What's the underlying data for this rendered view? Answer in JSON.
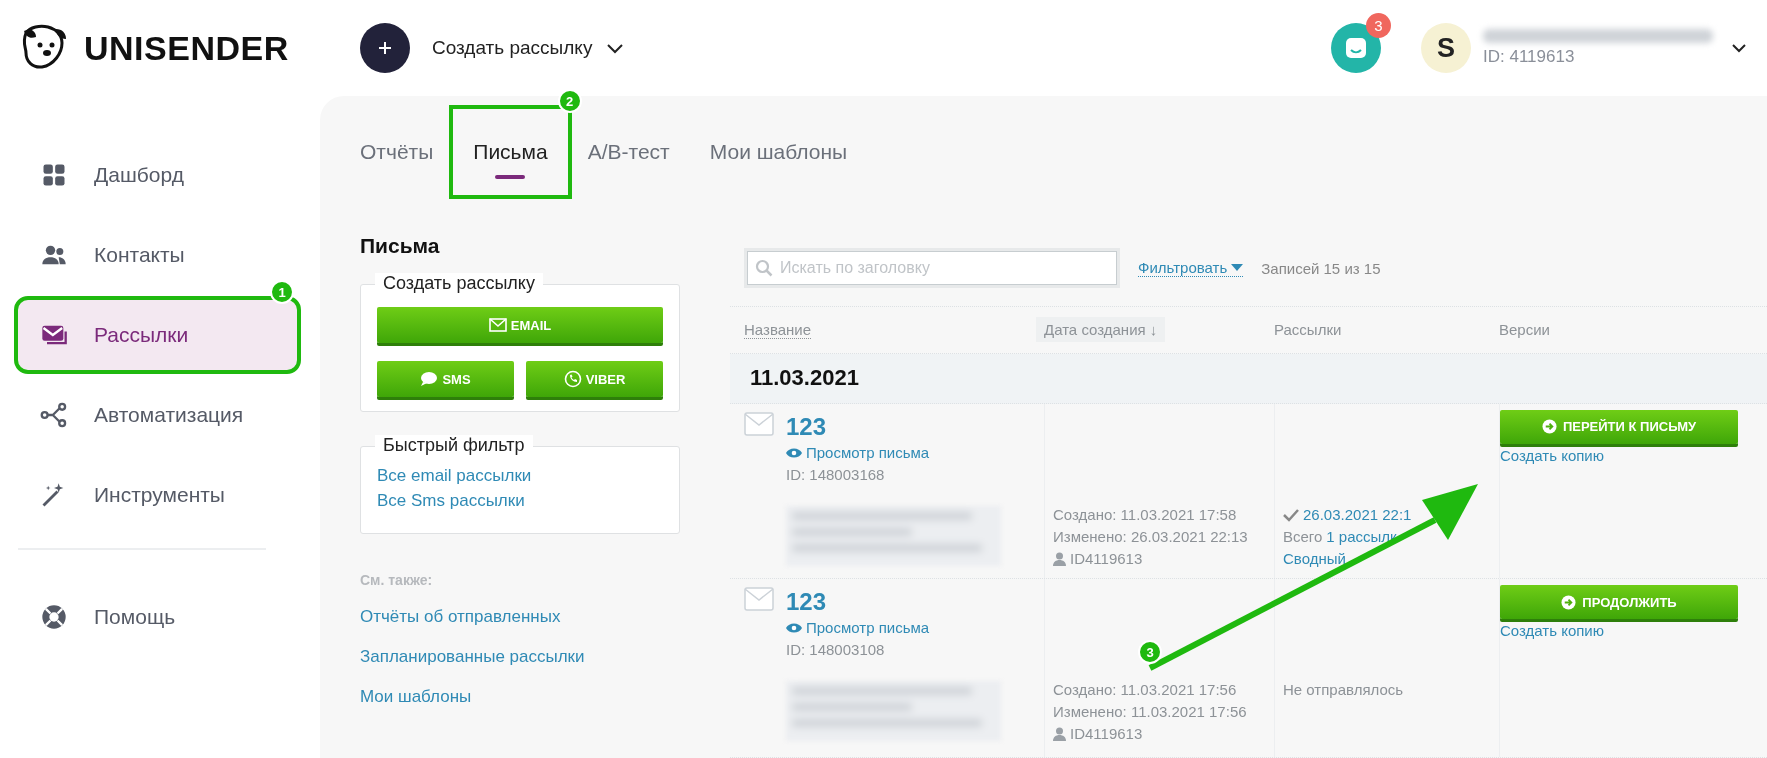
{
  "header": {
    "logo": "UNISENDER",
    "create_button": "Создать рассылку",
    "notification_count": "3",
    "user": {
      "avatar": "S",
      "id": "ID: 4119613"
    }
  },
  "sidebar": {
    "items": [
      {
        "label": "Дашборд",
        "selected": false
      },
      {
        "label": "Контакты",
        "selected": false
      },
      {
        "label": "Рассылки",
        "selected": true,
        "annotation": "1"
      },
      {
        "label": "Автоматизация",
        "selected": false
      },
      {
        "label": "Инструменты",
        "selected": false
      }
    ],
    "bottom_items": [
      {
        "label": "Помощь",
        "selected": false
      }
    ]
  },
  "tabs": [
    {
      "label": "Отчёты",
      "selected": false
    },
    {
      "label": "Письма",
      "selected": true,
      "annotation": "2"
    },
    {
      "label": "A/B-тест",
      "selected": false
    },
    {
      "label": "Мои шаблоны",
      "selected": false
    }
  ],
  "left_panel": {
    "title": "Письма",
    "create_box": {
      "legend": "Создать рассылку",
      "buttons": [
        "EMAIL",
        "SMS",
        "VIBER"
      ]
    },
    "quick_filter": {
      "legend": "Быстрый фильтр",
      "links": [
        "Все email рассылки",
        "Все Sms рассылки"
      ]
    },
    "see_also": {
      "title": "См. также:",
      "links": [
        "Отчёты об отправленных",
        "Запланированные рассылки",
        "Мои шаблоны"
      ]
    }
  },
  "toolbar": {
    "search": {
      "placeholder": "Искать по заголовку"
    },
    "filter": "Фильтровать",
    "count": "Записей 15 из 15"
  },
  "table": {
    "columns": [
      "Название",
      "Дата создания ↓",
      "Рассылки",
      "Версии"
    ],
    "group": "11.03.2021",
    "rows": [
      {
        "title": "123",
        "preview": "Просмотр письма",
        "id": "ID: 148003168",
        "created": "Создано: 11.03.2021 17:58",
        "modified": "Изменено: 26.03.2021 22:13",
        "author": "ID4119613",
        "mailing": {
          "kind": "sent",
          "date": "26.03.2021 22:1",
          "total": "Всего",
          "count_link": "1 рассылк",
          "report": "Сводный"
        },
        "action": "ПЕРЕЙТИ К ПИСЬМУ",
        "copy": "Создать копию"
      },
      {
        "title": "123",
        "preview": "Просмотр письма",
        "id": "ID: 148003108",
        "created": "Создано: 11.03.2021 17:56",
        "modified": "Изменено: 11.03.2021 17:56",
        "author": "ID4119613",
        "mailing": {
          "kind": "none",
          "status": "Не отправлялось"
        },
        "action": "ПРОДОЛЖИТЬ",
        "copy": "Создать копию"
      }
    ]
  },
  "annotation_arrow": {
    "badge": "3"
  }
}
